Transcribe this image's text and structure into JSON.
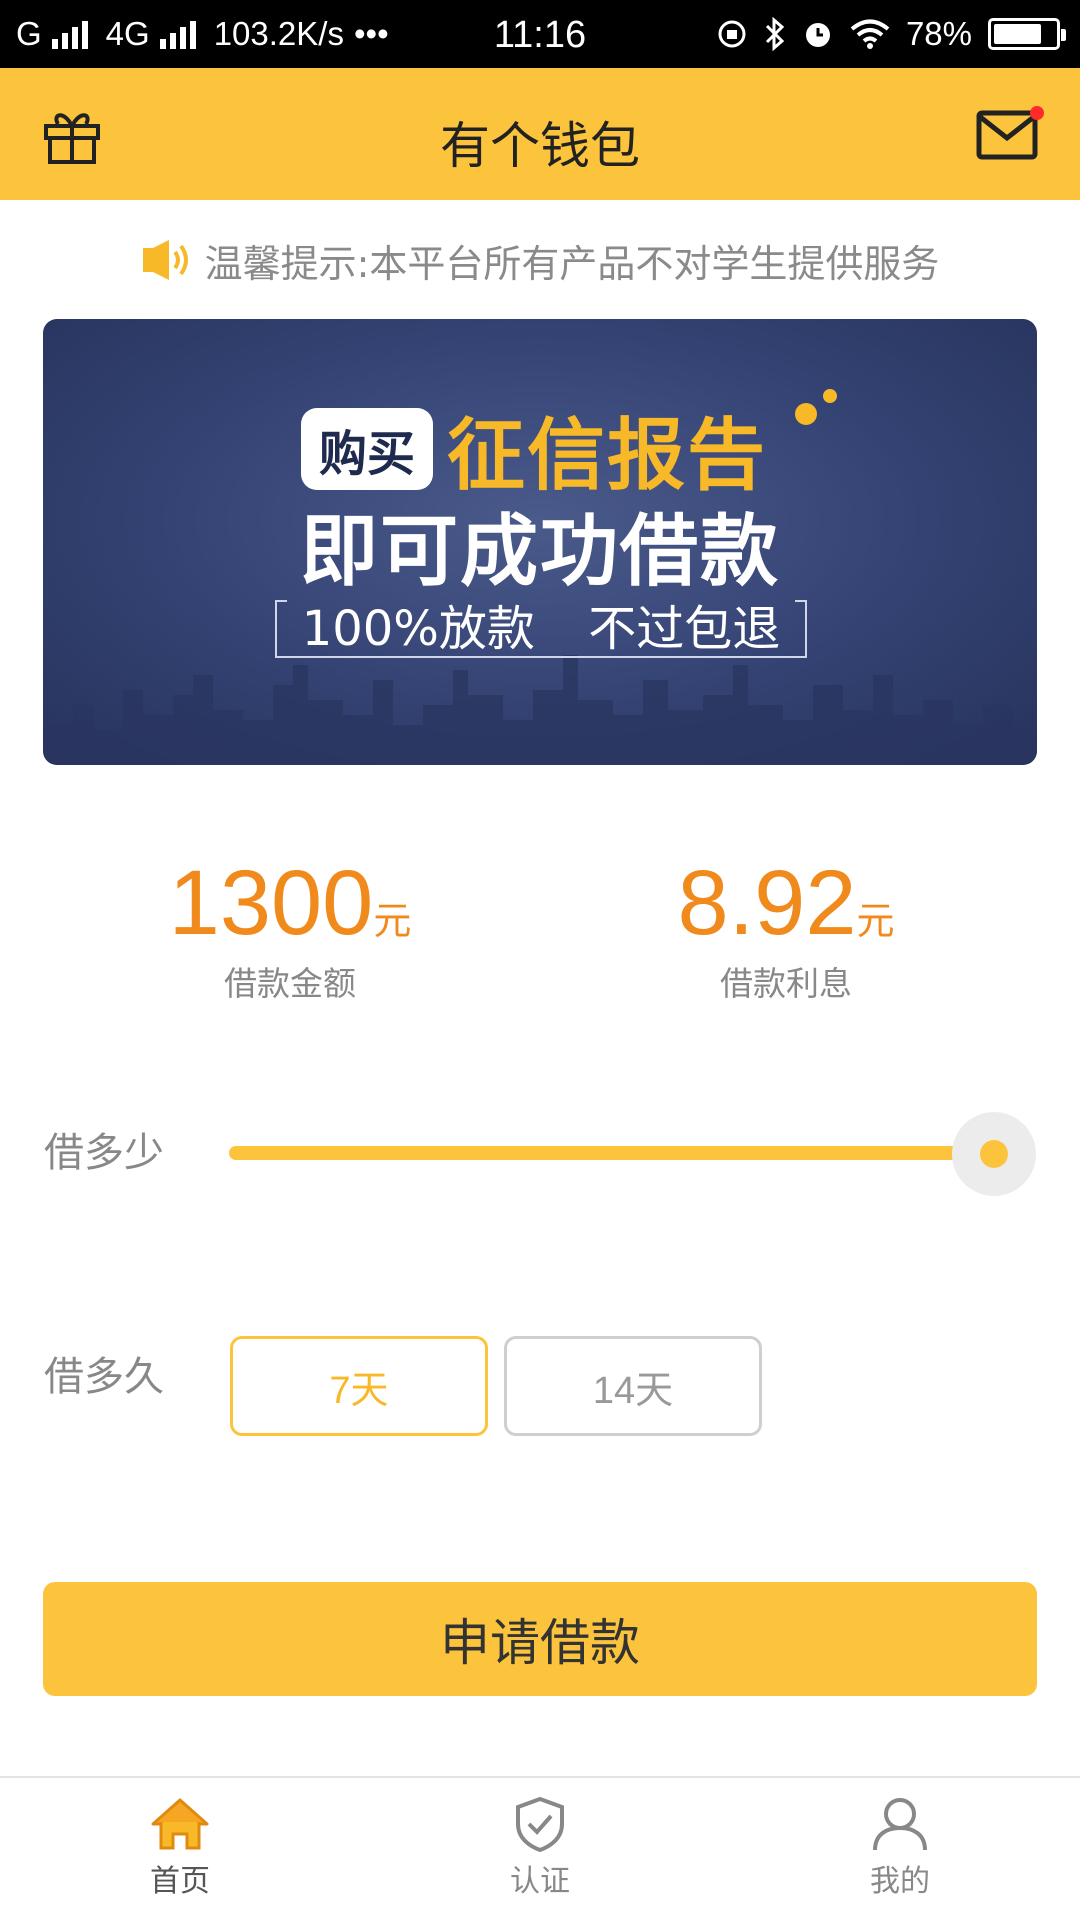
{
  "status_bar": {
    "carrier1": "G",
    "carrier2": "4G",
    "speed": "103.2K/s",
    "dots": "•••",
    "time": "11:16",
    "battery": "78%",
    "battery_level_percent": 78
  },
  "header": {
    "title": "有个钱包",
    "left_icon": "gift-icon",
    "right_icon": "mail-icon",
    "has_unread": true
  },
  "notice": {
    "icon": "speaker-icon",
    "text": "温馨提示:本平台所有产品不对学生提供服务"
  },
  "banner": {
    "tag": "购买",
    "highlight": "征信报告",
    "line2": "即可成功借款",
    "line3_left": "100%放款",
    "line3_right": "不过包退"
  },
  "loan": {
    "amount": "1300",
    "amount_unit": "元",
    "amount_label": "借款金额",
    "interest": "8.92",
    "interest_unit": "元",
    "interest_label": "借款利息"
  },
  "amount_slider": {
    "label": "借多少",
    "level_percent": 100
  },
  "duration": {
    "label": "借多久",
    "options": [
      "7天",
      "14天"
    ],
    "selected": "7天"
  },
  "apply_button": "申请借款",
  "bottom_nav": {
    "items": [
      {
        "label": "首页",
        "icon": "home-icon",
        "active": true
      },
      {
        "label": "认证",
        "icon": "shield-check-icon",
        "active": false
      },
      {
        "label": "我的",
        "icon": "user-icon",
        "active": false
      }
    ]
  },
  "colors": {
    "brand_yellow": "#fcc43c",
    "amount_orange": "#f08a1c",
    "banner_navy": "#334272",
    "unread_red": "#ff2a2a"
  }
}
